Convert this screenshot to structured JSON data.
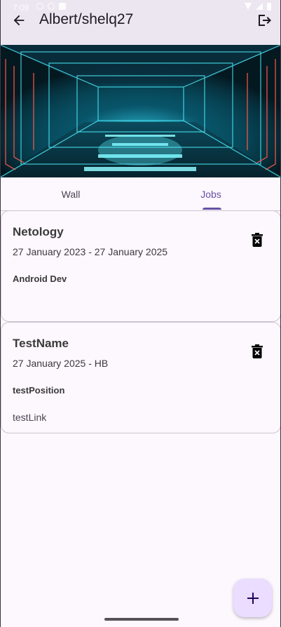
{
  "status_bar": {
    "time": "7:09"
  },
  "app_bar": {
    "title": "Albert/shelq27",
    "back_icon": "arrow-back-icon",
    "logout_icon": "logout-icon"
  },
  "banner": {
    "alt": "cyber corridor banner"
  },
  "tabs": [
    {
      "label": "Wall",
      "selected": false
    },
    {
      "label": "Jobs",
      "selected": true
    }
  ],
  "jobs": [
    {
      "name": "Netology",
      "dates": "27 January 2023 - 27 January 2025",
      "position": "Android Dev",
      "link": ""
    },
    {
      "name": "TestName",
      "dates": "27 January 2025 - HB",
      "position": "testPosition",
      "link": "testLink"
    }
  ],
  "fab": {
    "icon": "plus-icon"
  },
  "colors": {
    "accent": "#6750a4",
    "app_bar_bg": "#ece6f1",
    "background": "#fdf7fe",
    "fab_bg": "#eaddff"
  }
}
